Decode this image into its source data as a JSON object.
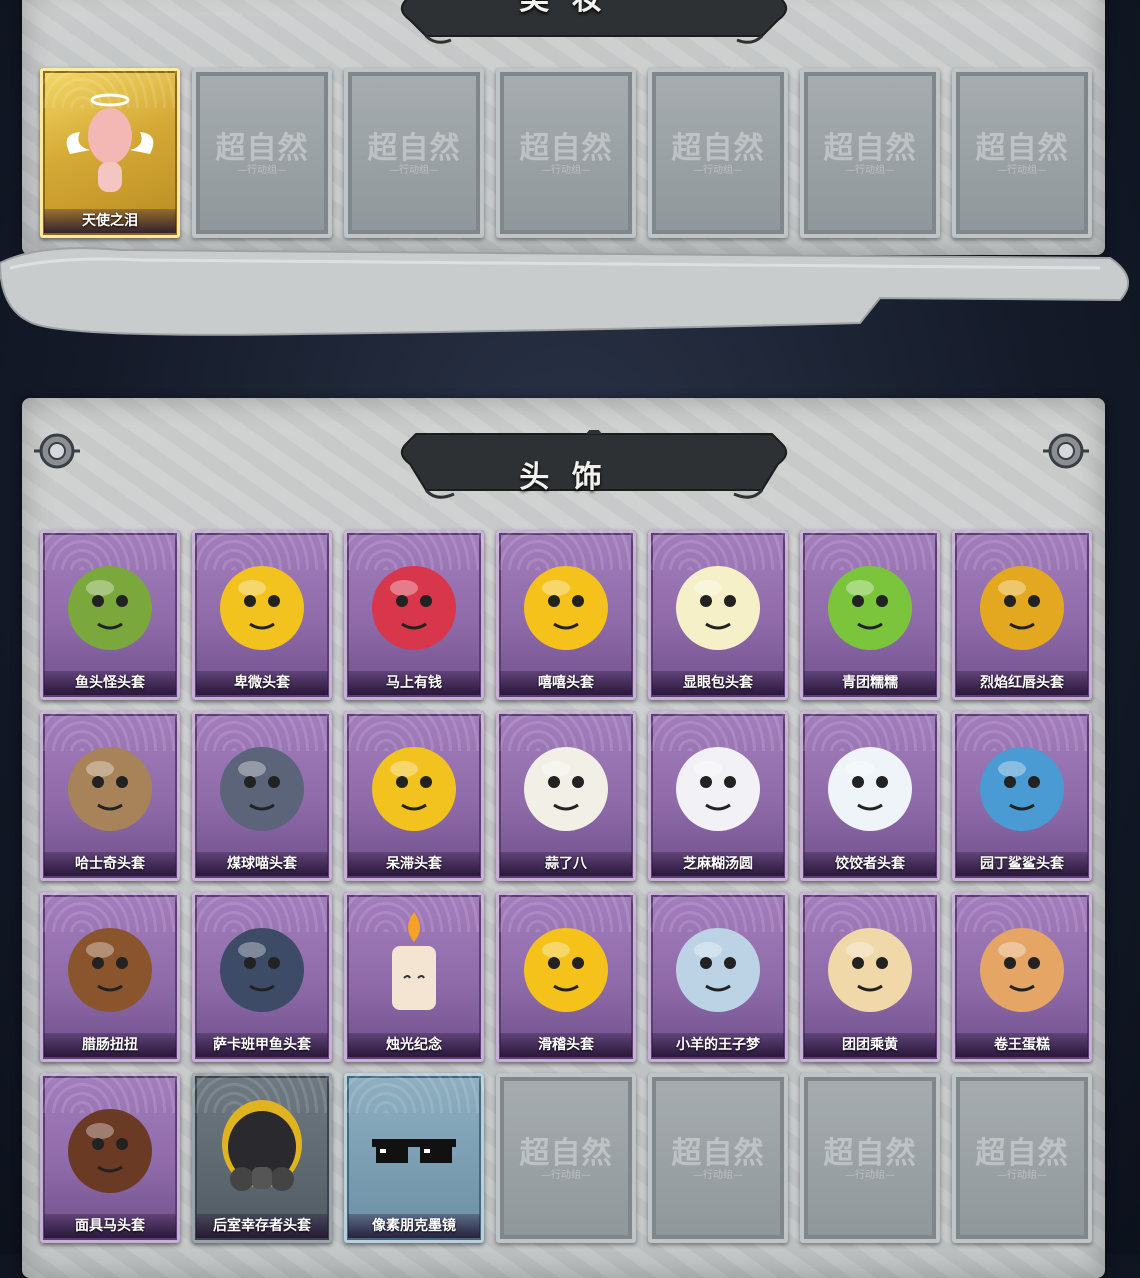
{
  "sections": {
    "makeup": {
      "title": "美 妆"
    },
    "headwear": {
      "title": "头 饰"
    }
  },
  "watermark": {
    "main": "超自然",
    "sub": "—行动组—"
  },
  "makeup_items": [
    {
      "label": "天使之泪",
      "icon": "angel-halo-wings-icon",
      "rarity": "gold"
    },
    {
      "label": "",
      "icon": "locked-placeholder",
      "rarity": "empty"
    },
    {
      "label": "",
      "icon": "locked-placeholder",
      "rarity": "empty"
    },
    {
      "label": "",
      "icon": "locked-placeholder",
      "rarity": "empty"
    },
    {
      "label": "",
      "icon": "locked-placeholder",
      "rarity": "empty"
    },
    {
      "label": "",
      "icon": "locked-placeholder",
      "rarity": "empty"
    },
    {
      "label": "",
      "icon": "locked-placeholder",
      "rarity": "empty"
    }
  ],
  "headwear_items": [
    {
      "label": "鱼头怪头套",
      "icon": "fish-head-icon",
      "rarity": "purple",
      "color": "#7aa83c"
    },
    {
      "label": "卑微头套",
      "icon": "humble-emoji-icon",
      "rarity": "purple",
      "color": "#f2c21e"
    },
    {
      "label": "马上有钱",
      "icon": "red-horse-icon",
      "rarity": "purple",
      "color": "#d8364a"
    },
    {
      "label": "嘻嘻头套",
      "icon": "grin-emoji-icon",
      "rarity": "purple",
      "color": "#f4c21b"
    },
    {
      "label": "显眼包头套",
      "icon": "lightbulb-crown-icon",
      "rarity": "purple",
      "color": "#f6f0c8"
    },
    {
      "label": "青团糯糯",
      "icon": "green-dumpling-icon",
      "rarity": "purple",
      "color": "#7bc53d"
    },
    {
      "label": "烈焰红唇头套",
      "icon": "pikachu-sunglasses-icon",
      "rarity": "purple",
      "color": "#e3a81f"
    },
    {
      "label": "哈士奇头套",
      "icon": "husky-sunglasses-icon",
      "rarity": "purple",
      "color": "#a8835a"
    },
    {
      "label": "煤球喵头套",
      "icon": "gray-cat-icon",
      "rarity": "purple",
      "color": "#5b6478"
    },
    {
      "label": "呆滞头套",
      "icon": "dazed-emoji-icon",
      "rarity": "purple",
      "color": "#f2c21e"
    },
    {
      "label": "蒜了八",
      "icon": "garlic-icon",
      "rarity": "purple",
      "color": "#f2efe6"
    },
    {
      "label": "芝麻糊汤圆",
      "icon": "rice-ball-icon",
      "rarity": "purple",
      "color": "#f2f2f6"
    },
    {
      "label": "饺饺者头套",
      "icon": "dumpling-cloud-icon",
      "rarity": "purple",
      "color": "#eef4f7"
    },
    {
      "label": "园丁鲨鲨头套",
      "icon": "shark-icon",
      "rarity": "purple",
      "color": "#4a9ad3"
    },
    {
      "label": "腊肠扭扭",
      "icon": "dachshund-icon",
      "rarity": "purple",
      "color": "#8a552c"
    },
    {
      "label": "萨卡班甲鱼头套",
      "icon": "sacabambaspis-icon",
      "rarity": "purple",
      "color": "#3d4b66"
    },
    {
      "label": "烛光纪念",
      "icon": "candle-icon",
      "rarity": "purple",
      "color": "#f4e5d3"
    },
    {
      "label": "滑稽头套",
      "icon": "smirk-emoji-icon",
      "rarity": "purple",
      "color": "#f4c21b"
    },
    {
      "label": "小羊的王子梦",
      "icon": "sheep-crown-icon",
      "rarity": "purple",
      "color": "#bcd3e6"
    },
    {
      "label": "团团乘黄",
      "icon": "horned-cat-icon",
      "rarity": "purple",
      "color": "#f0d8a8"
    },
    {
      "label": "卷王蛋糕",
      "icon": "roll-cake-icon",
      "rarity": "purple",
      "color": "#e5a564"
    },
    {
      "label": "面具马头套",
      "icon": "horse-mask-icon",
      "rarity": "purple",
      "color": "#6a3a24"
    },
    {
      "label": "后室幸存者头套",
      "icon": "gas-mask-helmet-icon",
      "rarity": "gray",
      "color": "#2a2a2e"
    },
    {
      "label": "像素朋克墨镜",
      "icon": "pixel-sunglasses-icon",
      "rarity": "teal",
      "color": "#111111"
    },
    {
      "label": "",
      "icon": "locked-placeholder",
      "rarity": "empty"
    },
    {
      "label": "",
      "icon": "locked-placeholder",
      "rarity": "empty"
    },
    {
      "label": "",
      "icon": "locked-placeholder",
      "rarity": "empty"
    },
    {
      "label": "",
      "icon": "locked-placeholder",
      "rarity": "empty"
    }
  ]
}
